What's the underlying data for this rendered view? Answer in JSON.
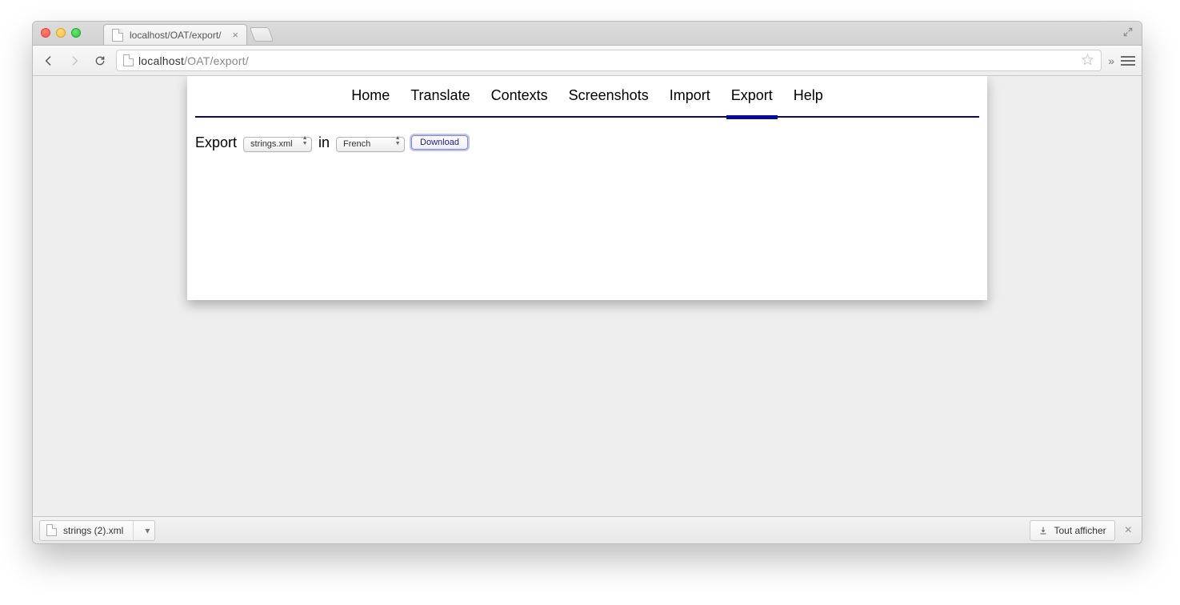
{
  "browser": {
    "tab_title": "localhost/OAT/export/",
    "url_host": "localhost",
    "url_rest": "/OAT/export/"
  },
  "nav": {
    "items": [
      {
        "label": "Home"
      },
      {
        "label": "Translate"
      },
      {
        "label": "Contexts"
      },
      {
        "label": "Screenshots"
      },
      {
        "label": "Import"
      },
      {
        "label": "Export",
        "active": true
      },
      {
        "label": "Help"
      }
    ]
  },
  "export_form": {
    "label_export": "Export",
    "file_selected": "strings.xml",
    "label_in": "in",
    "language_selected": "French",
    "download_label": "Download"
  },
  "downloads": {
    "item_name": "strings (2).xml",
    "show_all_label": "Tout afficher"
  }
}
